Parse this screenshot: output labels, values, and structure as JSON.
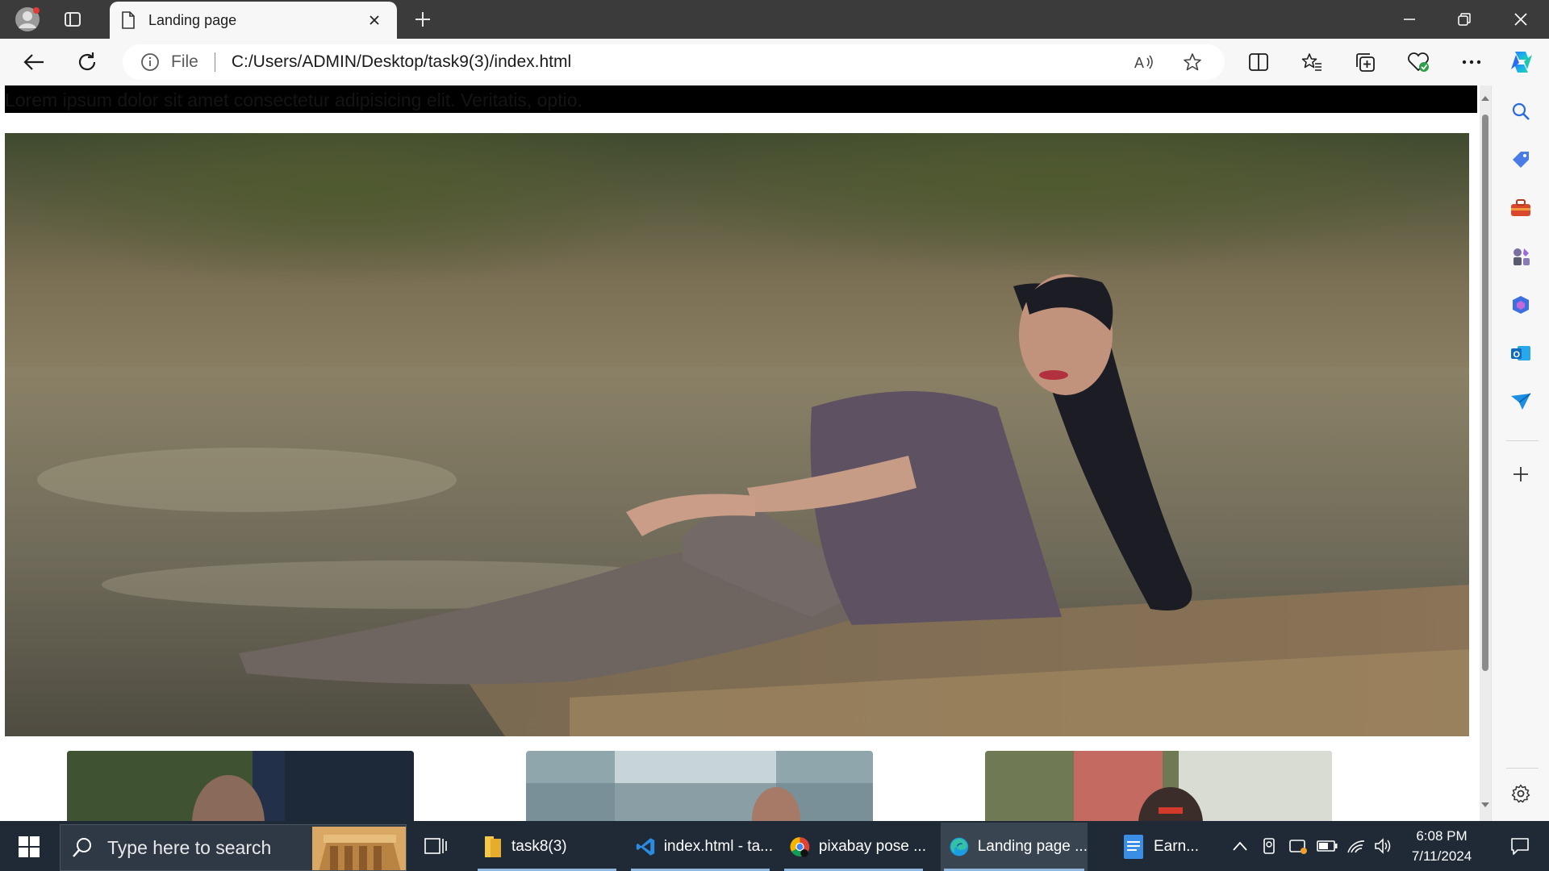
{
  "browser": {
    "tab_title": "Landing page",
    "address_scheme": "File",
    "address_url": "C:/Users/ADMIN/Desktop/task9(3)/index.html"
  },
  "page": {
    "banner_text": "Lorem ipsum dolor sit amet consectetur adipisicing elit. Veritatis, optio."
  },
  "taskbar": {
    "search_placeholder": "Type here to search",
    "apps": [
      {
        "label": "task8(3)",
        "icon": "folder-icon"
      },
      {
        "label": "index.html - ta...",
        "icon": "vscode-icon"
      },
      {
        "label": "pixabay pose ...",
        "icon": "chrome-icon"
      },
      {
        "label": "Landing page ...",
        "icon": "edge-icon"
      },
      {
        "label": "Earn...",
        "icon": "document-icon"
      }
    ],
    "time": "6:08 PM",
    "date": "7/11/2024"
  },
  "colors": {
    "titlebar": "#3b3b3b",
    "taskbar": "#1f2a36",
    "banner": "#000000"
  }
}
